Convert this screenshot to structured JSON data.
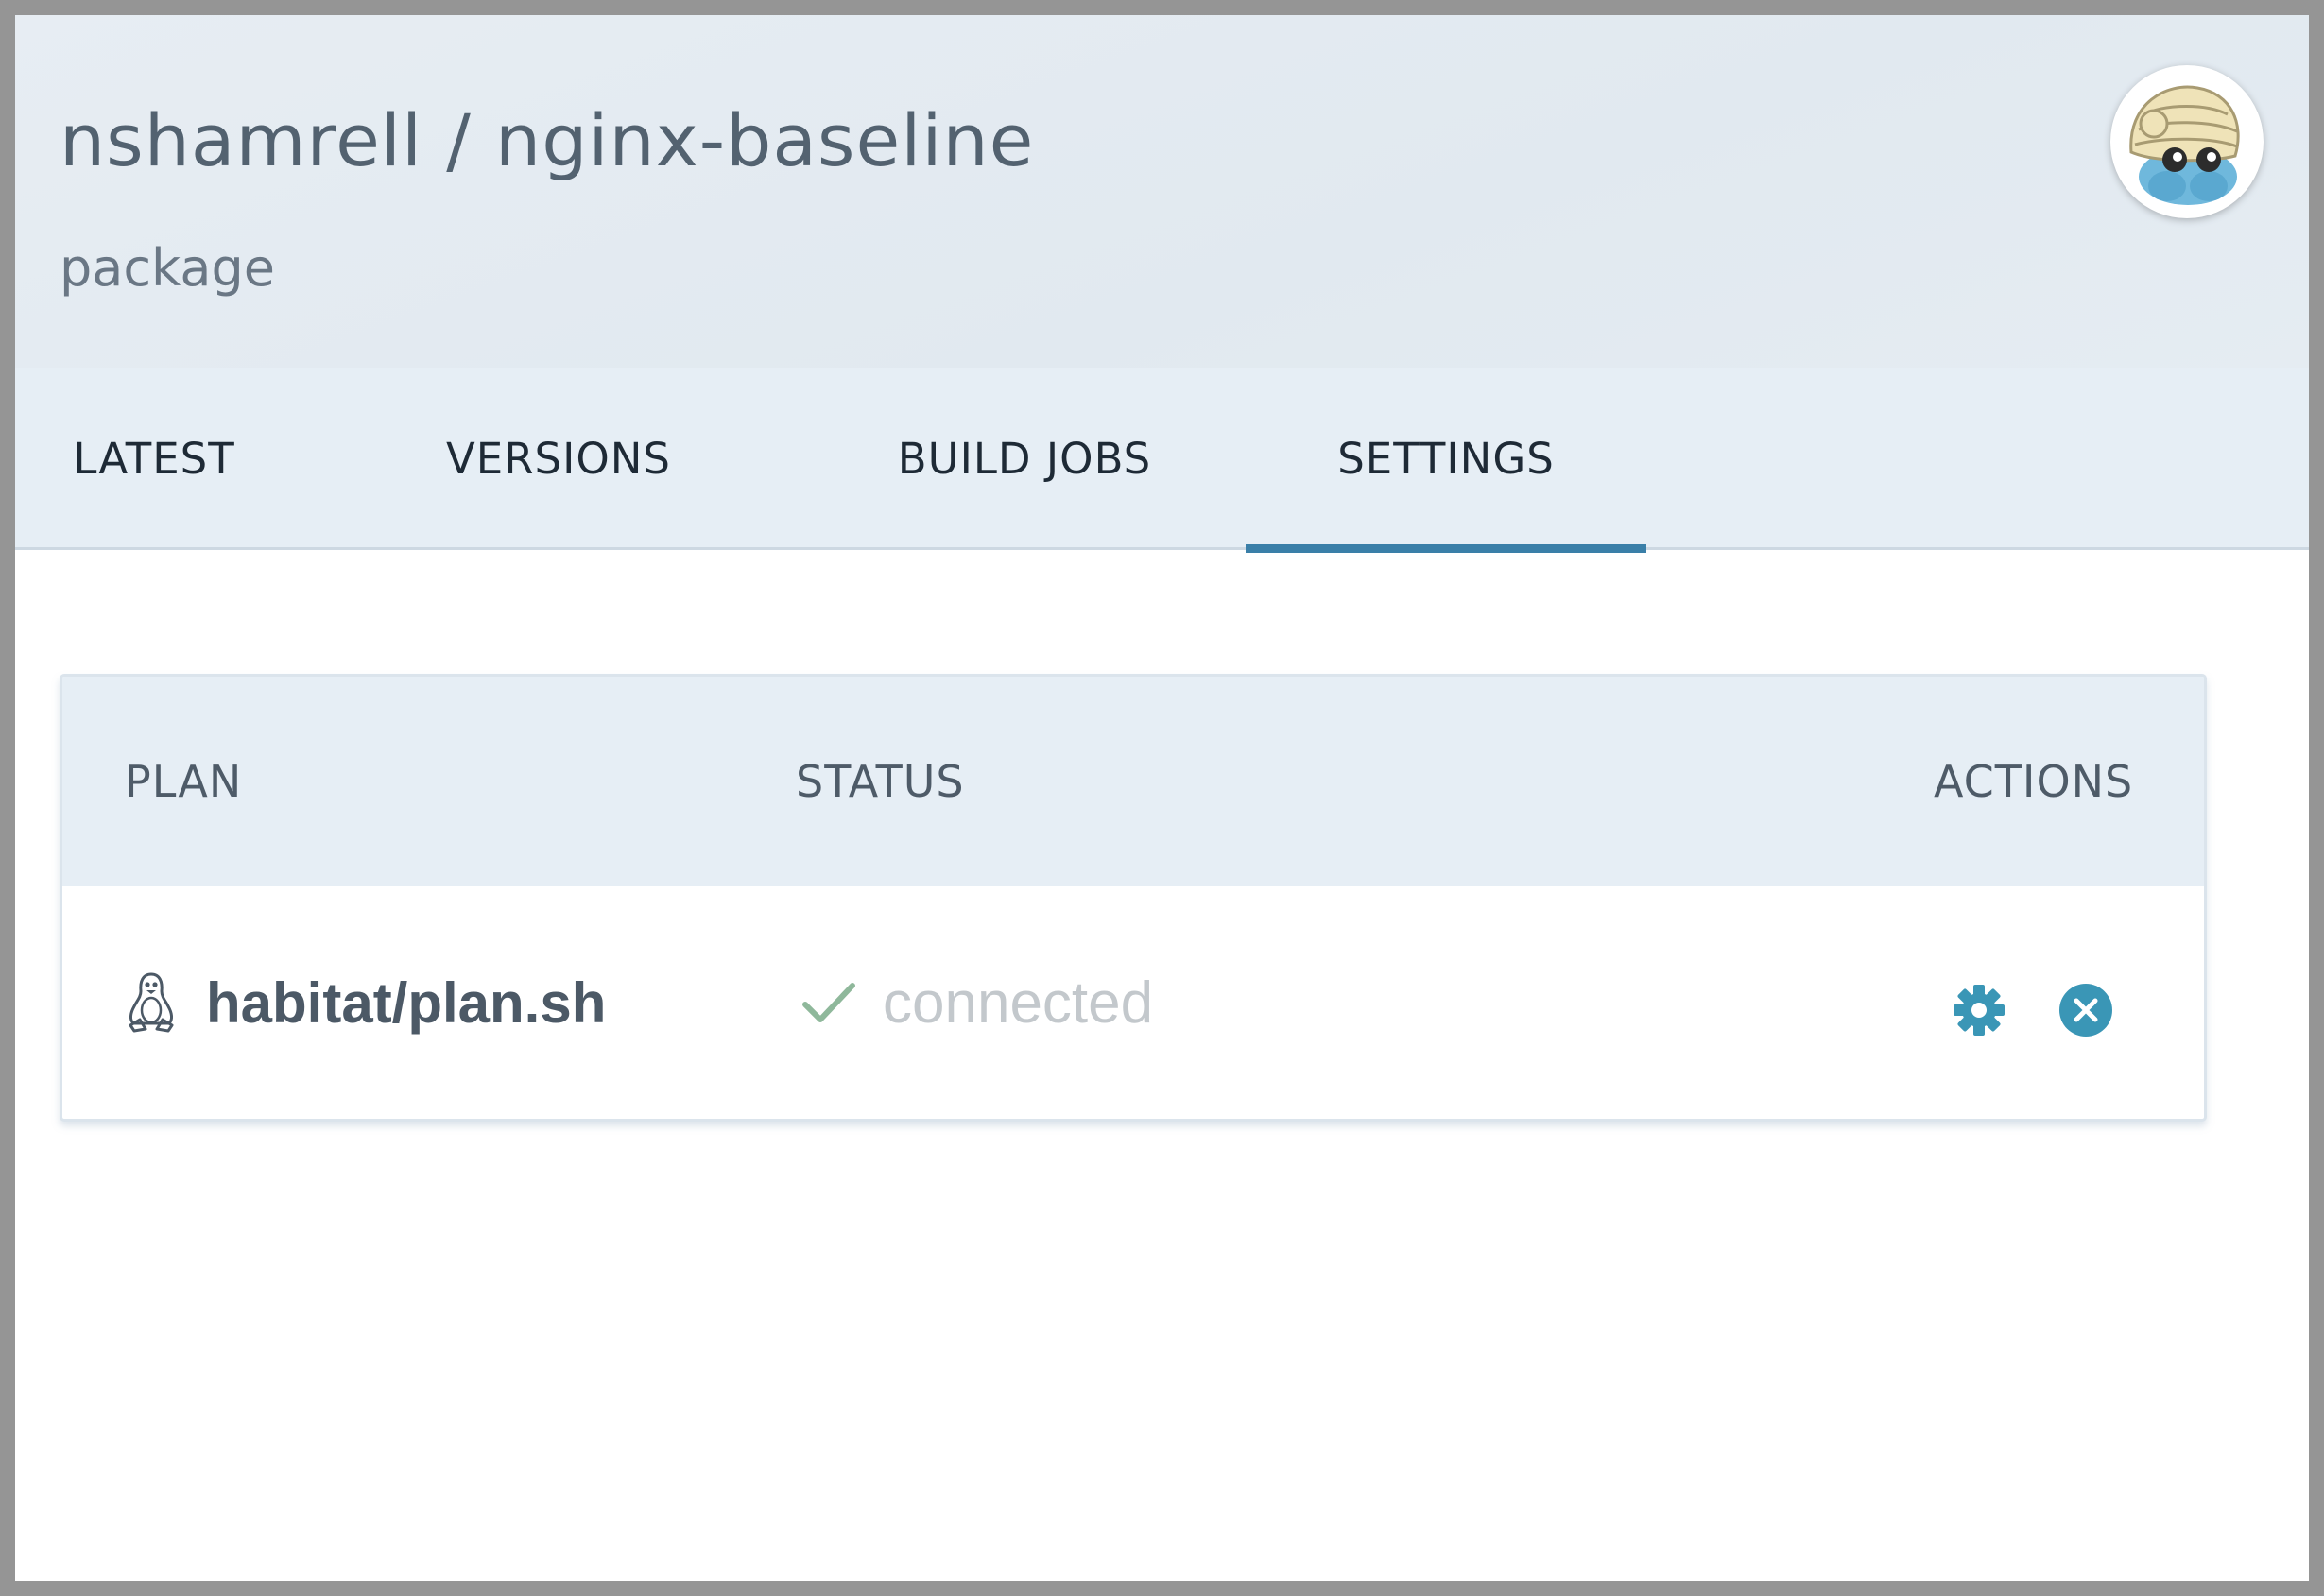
{
  "header": {
    "title": "nshamrell / nginx-baseline",
    "subtitle": "package",
    "avatar_icon": "avatar-omanyte-icon"
  },
  "tabs": [
    {
      "label": "LATEST",
      "active": false
    },
    {
      "label": "VERSIONS",
      "active": false
    },
    {
      "label": "BUILD JOBS",
      "active": false
    },
    {
      "label": "SETTINGS",
      "active": true
    }
  ],
  "table": {
    "columns": {
      "plan": "PLAN",
      "status": "STATUS",
      "actions": "ACTIONS"
    },
    "rows": [
      {
        "platform_icon": "linux-penguin-icon",
        "plan": "habitat/plan.sh",
        "status_icon": "checkmark-icon",
        "status": "connected",
        "actions": [
          "gear-icon",
          "close-circle-icon"
        ]
      }
    ]
  },
  "colors": {
    "accent": "#3a7fa8",
    "action_icon": "#3a96b6",
    "status_check": "#8fb89b",
    "header_bg": "#e6eef5"
  }
}
